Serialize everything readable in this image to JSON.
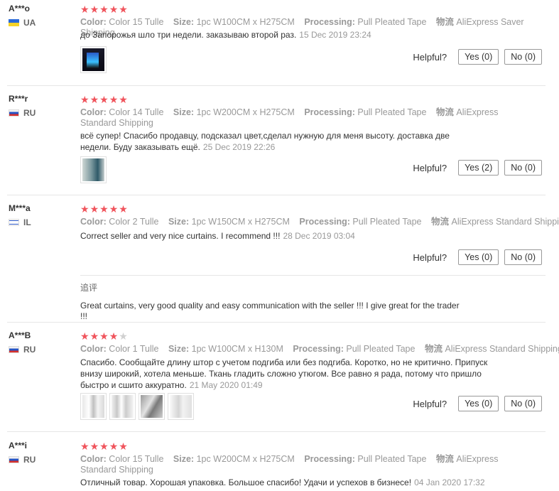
{
  "labels": {
    "color": "Color:",
    "size": "Size:",
    "processing": "Processing:",
    "shipping": "物流",
    "helpful": "Helpful?",
    "followup": "追评"
  },
  "reviews": [
    {
      "user": "A***o",
      "country": "UA",
      "flag": "ua",
      "rating": 5,
      "color": "Color 15 Tulle",
      "size": "1pc W100CM x H275CM",
      "processing": "Pull Pleated Tape",
      "shipping": "AliExpress Saver Shipping",
      "text": "до Запорожья шло три недели. заказываю второй раз.",
      "date": "15 Dec 2019 23:24",
      "thumbs": 1,
      "yes": "Yes (0)",
      "no": "No (0)"
    },
    {
      "user": "R***r",
      "country": "RU",
      "flag": "ru",
      "rating": 5,
      "color": "Color 14 Tulle",
      "size": "1pc W200CM x H275CM",
      "processing": "Pull Pleated Tape",
      "shipping": "AliExpress Standard Shipping",
      "text": "всё супер! Спасибо продавцу, подсказал цвет,сделал нужную для меня высоту. доставка две недели. Буду заказывать ещё.",
      "date": "25 Dec 2019 22:26",
      "thumbs": 1,
      "yes": "Yes (2)",
      "no": "No (0)"
    },
    {
      "user": "M***a",
      "country": "IL",
      "flag": "il",
      "rating": 5,
      "color": "Color 2 Tulle",
      "size": "1pc W150CM x H275CM",
      "processing": "Pull Pleated Tape",
      "shipping": "AliExpress Standard Shipping",
      "text": "Correct seller and very nice curtains. I recommend !!!",
      "date": "28 Dec 2019 03:04",
      "thumbs": 0,
      "yes": "Yes (0)",
      "no": "No (0)",
      "followup": "Great curtains, very good quality and easy communication with the seller !!! I give great for the trader !!!"
    },
    {
      "user": "A***B",
      "country": "RU",
      "flag": "ru",
      "rating": 4,
      "color": "Color 1 Tulle",
      "size": "1pc W100CM x H130M",
      "processing": "Pull Pleated Tape",
      "shipping": "AliExpress Standard Shipping",
      "text": "Спасибо. Сообщайте длину штор с учетом подгиба или без подгиба. Коротко, но не критично. Припуск внизу широкий, хотела меньше. Ткань гладить сложно утюгом. Все равно я рада, потому что пришло быстро и сшито аккуратно.",
      "date": "21 May 2020 01:49",
      "thumbs": 4,
      "yes": "Yes (0)",
      "no": "No (0)"
    },
    {
      "user": "A***i",
      "country": "RU",
      "flag": "ru",
      "rating": 5,
      "color": "Color 15 Tulle",
      "size": "1pc W200CM x H275CM",
      "processing": "Pull Pleated Tape",
      "shipping": "AliExpress Standard Shipping",
      "text": "Отличный товар. Хорошая упаковка. Большое спасибо! Удачи и успехов в бизнесе!",
      "date": "04 Jan 2020 17:32"
    }
  ]
}
